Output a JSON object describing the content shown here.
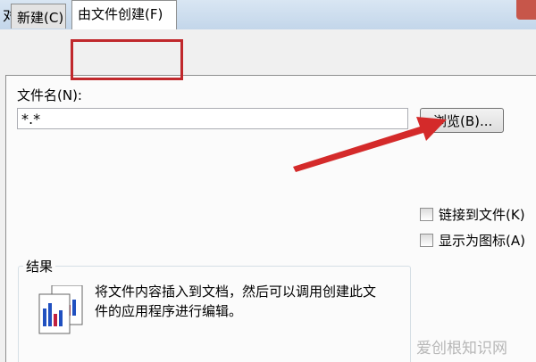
{
  "window": {
    "title": "对象"
  },
  "tabs": [
    {
      "label": "新建(C)"
    },
    {
      "label": "由文件创建(F)"
    }
  ],
  "file": {
    "name_label": "文件名(N):",
    "value": "*.*",
    "browse_label": "浏览(B)..."
  },
  "options": {
    "link_label": "链接到文件(K)",
    "icon_label": "显示为图标(A)",
    "link_checked": false,
    "icon_checked": false
  },
  "result": {
    "legend": "结果",
    "text": "将文件内容插入到文档，然后可以调用创建此文件的应用程序进行编辑。"
  },
  "watermark": "爱创根知识网",
  "colors": {
    "annotation": "#c0282c"
  }
}
